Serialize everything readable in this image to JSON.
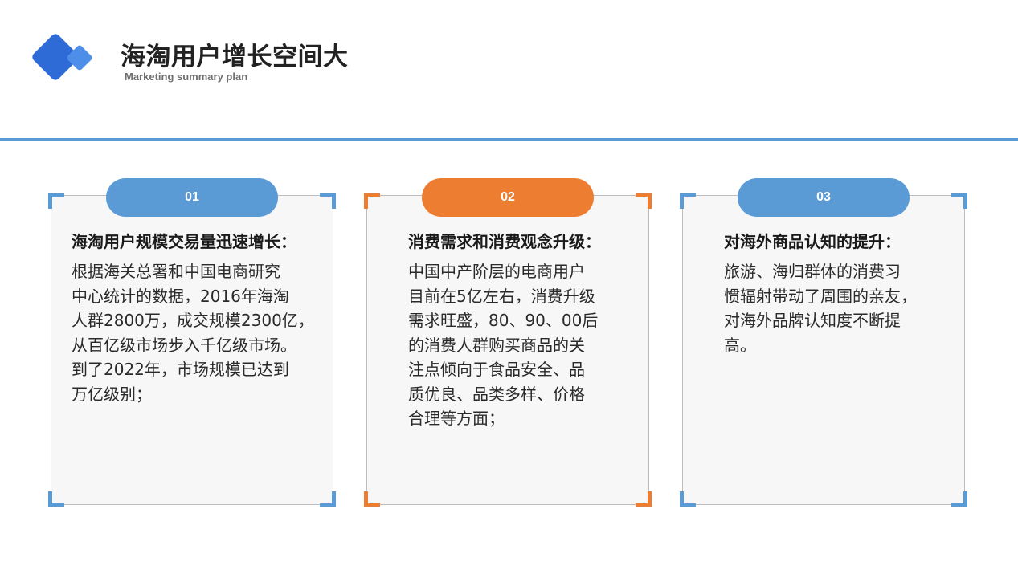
{
  "header": {
    "title": "海淘用户增长空间大",
    "subtitle": "Marketing summary plan"
  },
  "colors": {
    "blue": "#5b9bd5",
    "orange": "#ed7d31",
    "logo_dark": "#2f6bd6",
    "logo_light": "#4d8ee8"
  },
  "icons": {
    "logo": "double-diamond-logo"
  },
  "cards": [
    {
      "number": "01",
      "accent": "#5b9bd5",
      "heading": "海淘用户规模交易量迅速增长：",
      "body_lines": [
        "根据海关总署和中国电商研究",
        "中心统计的数据，2016年海淘",
        "人群2800万，成交规模2300亿，",
        "从百亿级市场步入千亿级市场。",
        "到了2022年，市场规模已达到",
        "万亿级别；"
      ]
    },
    {
      "number": "02",
      "accent": "#ed7d31",
      "heading": "消费需求和消费观念升级：",
      "body_lines": [
        "中国中产阶层的电商用户",
        "目前在5亿左右，消费升级",
        "需求旺盛，80、90、00后",
        "的消费人群购买商品的关",
        "注点倾向于食品安全、品",
        "质优良、品类多样、价格",
        "合理等方面；"
      ]
    },
    {
      "number": "03",
      "accent": "#5b9bd5",
      "heading": "对海外商品认知的提升：",
      "body_lines": [
        "旅游、海归群体的消费习",
        "惯辐射带动了周围的亲友，",
        "对海外品牌认知度不断提",
        "高。"
      ]
    }
  ]
}
